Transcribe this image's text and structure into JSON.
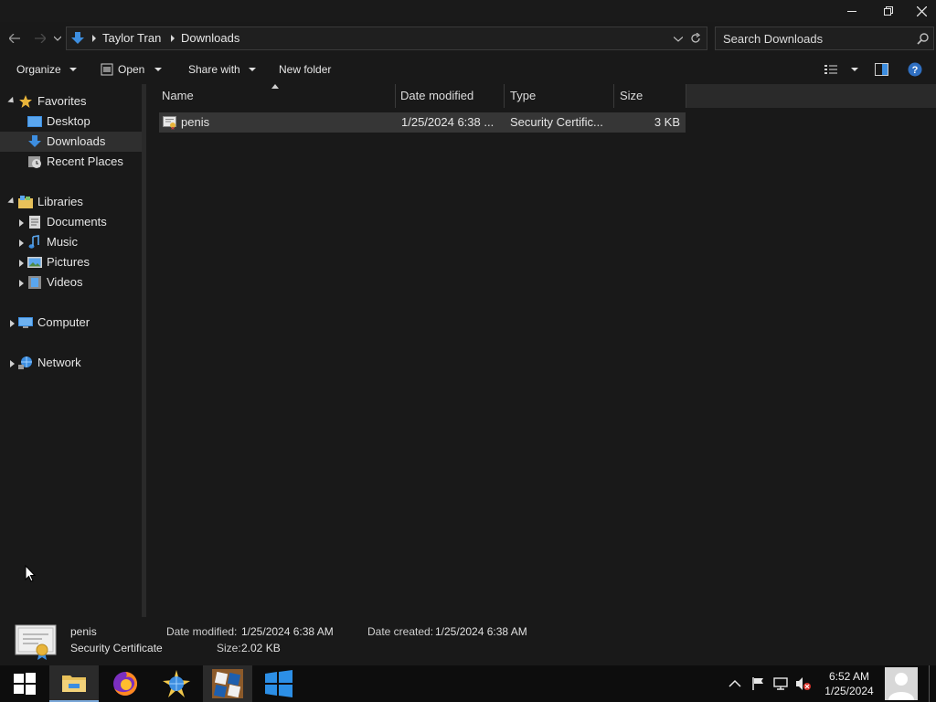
{
  "window": {
    "minimize_icon": "minimize-icon",
    "maximize_icon": "restore-icon",
    "close_icon": "close-icon"
  },
  "address": {
    "crumbs": [
      "Taylor Tran",
      "Downloads"
    ],
    "search_placeholder": "Search Downloads"
  },
  "toolbar": {
    "organize": "Organize",
    "open": "Open",
    "share_with": "Share with",
    "new_folder": "New folder"
  },
  "nav": {
    "favorites": "Favorites",
    "desktop": "Desktop",
    "downloads": "Downloads",
    "recent_places": "Recent Places",
    "libraries": "Libraries",
    "documents": "Documents",
    "music": "Music",
    "pictures": "Pictures",
    "videos": "Videos",
    "computer": "Computer",
    "network": "Network"
  },
  "columns": {
    "name": "Name",
    "date_modified": "Date modified",
    "type": "Type",
    "size": "Size"
  },
  "files": [
    {
      "name": "penis",
      "date_modified": "1/25/2024 6:38 ...",
      "type": "Security Certific...",
      "size": "3 KB"
    }
  ],
  "details": {
    "name": "penis",
    "type": "Security Certificate",
    "date_modified_label": "Date modified:",
    "date_modified": "1/25/2024 6:38 AM",
    "date_created_label": "Date created:",
    "date_created": "1/25/2024 6:38 AM",
    "size_label": "Size:",
    "size": "2.02 KB"
  },
  "taskbar": {
    "time": "6:52 AM",
    "date": "1/25/2024"
  },
  "colors": {
    "accent_blue": "#3d8ee0",
    "folder_yellow": "#e8c15a",
    "selection_bg": "#363636"
  }
}
